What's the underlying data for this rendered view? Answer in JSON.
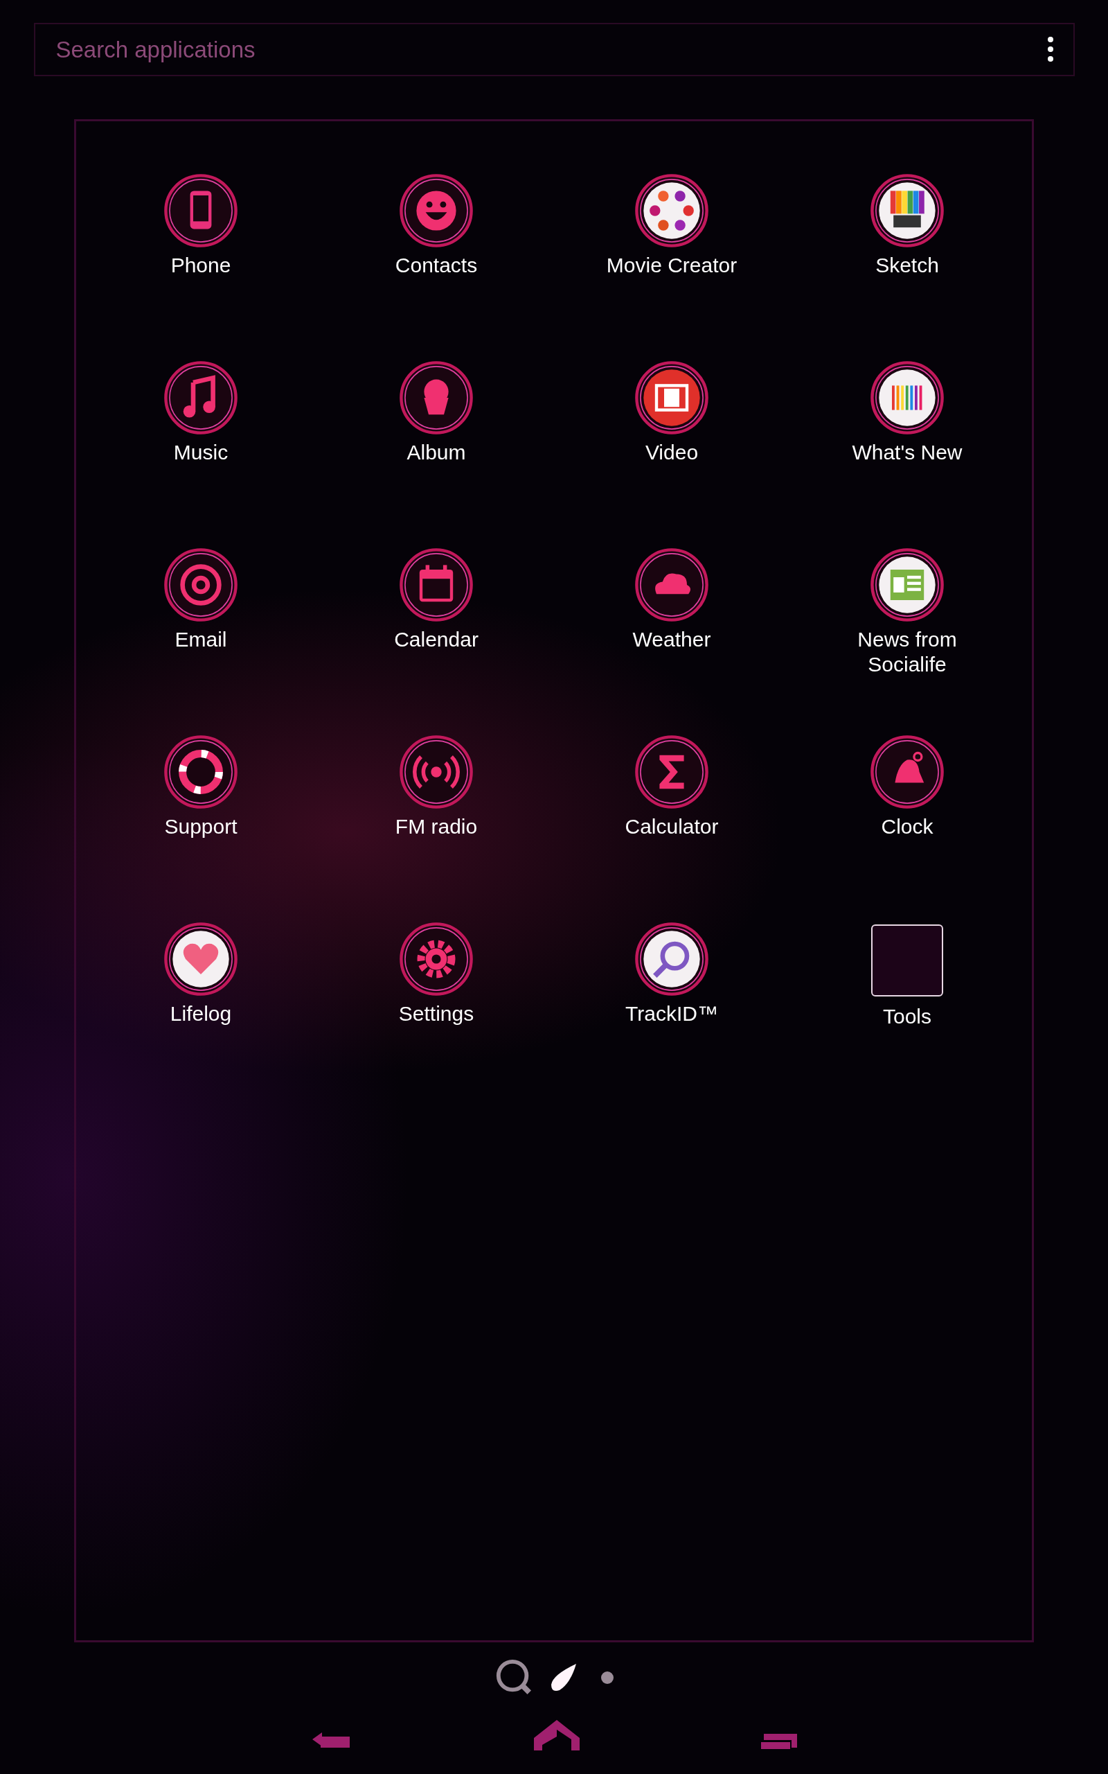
{
  "search": {
    "placeholder": "Search applications"
  },
  "apps": [
    {
      "label": "Phone",
      "kind": "app"
    },
    {
      "label": "Contacts",
      "kind": "app"
    },
    {
      "label": "Movie Creator",
      "kind": "app"
    },
    {
      "label": "Sketch",
      "kind": "app"
    },
    {
      "label": "Music",
      "kind": "app"
    },
    {
      "label": "Album",
      "kind": "app"
    },
    {
      "label": "Video",
      "kind": "app"
    },
    {
      "label": "What's New",
      "kind": "app"
    },
    {
      "label": "Email",
      "kind": "app"
    },
    {
      "label": "Calendar",
      "kind": "app"
    },
    {
      "label": "Weather",
      "kind": "app"
    },
    {
      "label": "News from Socialife",
      "kind": "app"
    },
    {
      "label": "Support",
      "kind": "app"
    },
    {
      "label": "FM radio",
      "kind": "app"
    },
    {
      "label": "Calculator",
      "kind": "app"
    },
    {
      "label": "Clock",
      "kind": "app"
    },
    {
      "label": "Lifelog",
      "kind": "app"
    },
    {
      "label": "Settings",
      "kind": "app"
    },
    {
      "label": "TrackID™",
      "kind": "app"
    },
    {
      "label": "Tools",
      "kind": "folder"
    }
  ],
  "page_indicator": [
    {
      "kind": "search",
      "selected": false
    },
    {
      "kind": "drop",
      "selected": true
    },
    {
      "kind": "dot",
      "selected": false
    }
  ]
}
